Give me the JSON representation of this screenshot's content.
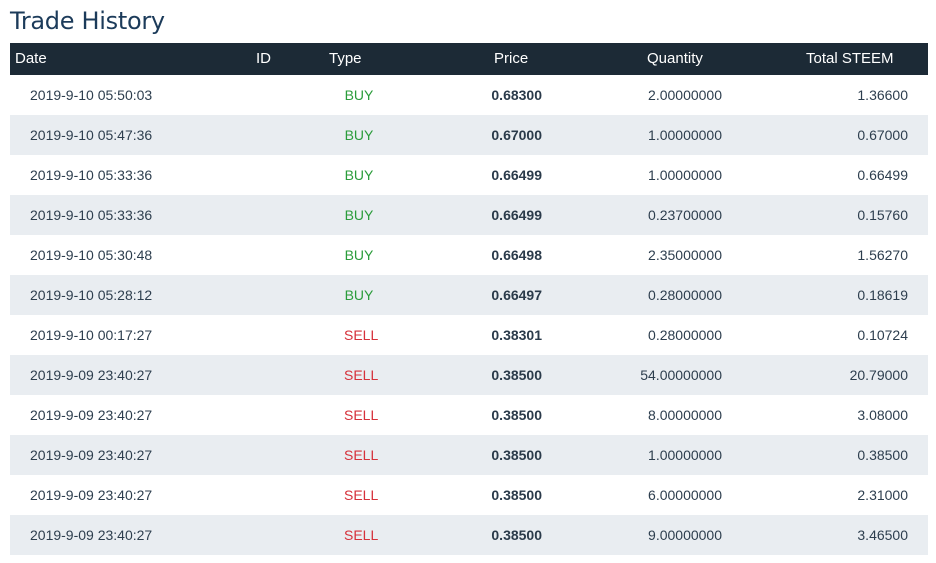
{
  "page": {
    "title": "Trade History"
  },
  "table": {
    "headers": {
      "date": "Date",
      "id": "ID",
      "type": "Type",
      "price": "Price",
      "quantity": "Quantity",
      "total": "Total STEEM"
    },
    "rows": [
      {
        "date": "2019-9-10 05:50:03",
        "type": "BUY",
        "price": "0.68300",
        "quantity": "2.00000000",
        "total": "1.36600"
      },
      {
        "date": "2019-9-10 05:47:36",
        "type": "BUY",
        "price": "0.67000",
        "quantity": "1.00000000",
        "total": "0.67000"
      },
      {
        "date": "2019-9-10 05:33:36",
        "type": "BUY",
        "price": "0.66499",
        "quantity": "1.00000000",
        "total": "0.66499"
      },
      {
        "date": "2019-9-10 05:33:36",
        "type": "BUY",
        "price": "0.66499",
        "quantity": "0.23700000",
        "total": "0.15760"
      },
      {
        "date": "2019-9-10 05:30:48",
        "type": "BUY",
        "price": "0.66498",
        "quantity": "2.35000000",
        "total": "1.56270"
      },
      {
        "date": "2019-9-10 05:28:12",
        "type": "BUY",
        "price": "0.66497",
        "quantity": "0.28000000",
        "total": "0.18619"
      },
      {
        "date": "2019-9-10 00:17:27",
        "type": "SELL",
        "price": "0.38301",
        "quantity": "0.28000000",
        "total": "0.10724"
      },
      {
        "date": "2019-9-09 23:40:27",
        "type": "SELL",
        "price": "0.38500",
        "quantity": "54.00000000",
        "total": "20.79000"
      },
      {
        "date": "2019-9-09 23:40:27",
        "type": "SELL",
        "price": "0.38500",
        "quantity": "8.00000000",
        "total": "3.08000"
      },
      {
        "date": "2019-9-09 23:40:27",
        "type": "SELL",
        "price": "0.38500",
        "quantity": "1.00000000",
        "total": "0.38500"
      },
      {
        "date": "2019-9-09 23:40:27",
        "type": "SELL",
        "price": "0.38500",
        "quantity": "6.00000000",
        "total": "2.31000"
      },
      {
        "date": "2019-9-09 23:40:27",
        "type": "SELL",
        "price": "0.38500",
        "quantity": "9.00000000",
        "total": "3.46500"
      }
    ]
  },
  "colors": {
    "header_bg": "#1c2a36",
    "title": "#1c3b5a",
    "buy": "#2a9c3a",
    "sell": "#d6303a",
    "stripe": "#e9edf1"
  }
}
